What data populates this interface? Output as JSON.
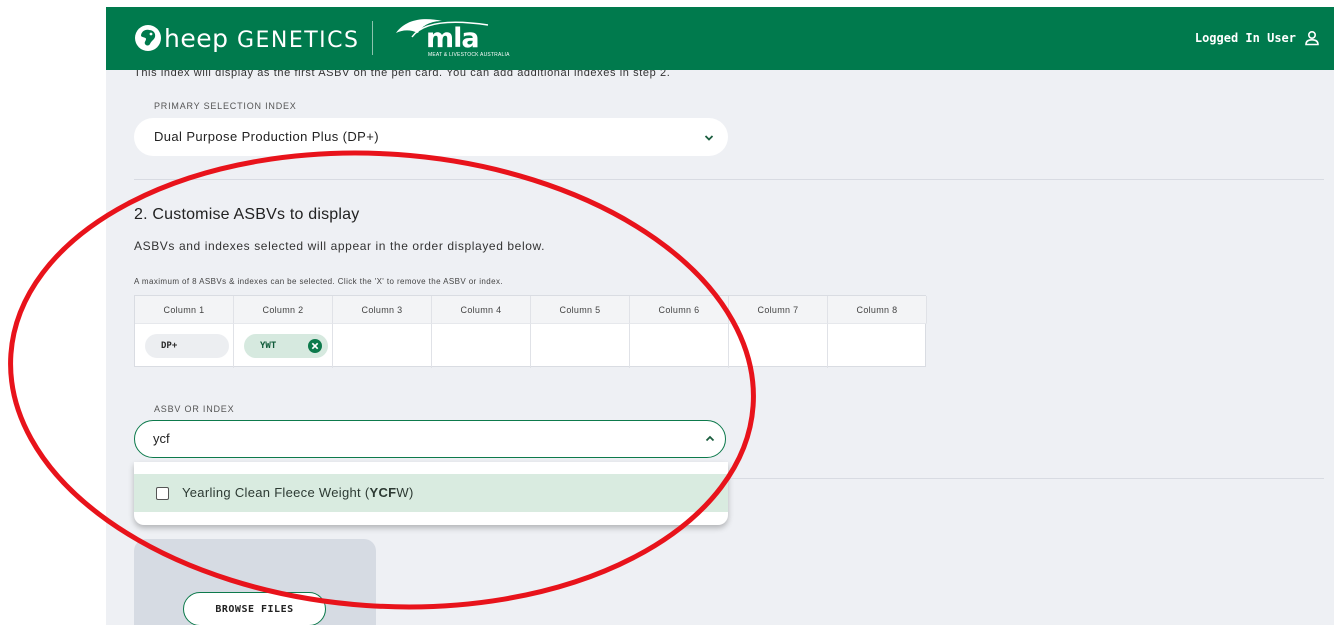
{
  "header": {
    "brand_initial_glyph": "sheep-head-icon",
    "brand_text_a": "heep ",
    "brand_text_b": "GENETICS",
    "partner_logo_text": "mla",
    "partner_logo_subtext": "MEAT & LIVESTOCK AUSTRALIA",
    "user_label": "Logged In User",
    "bg_color": "#007a4d"
  },
  "step1": {
    "intro_text": "This index will display as the first ASBV on the pen card. You can add additional indexes in step 2.",
    "primary_index_label": "PRIMARY SELECTION INDEX",
    "primary_index_value": "Dual Purpose Production Plus (DP+)"
  },
  "step2": {
    "title": "2. Customise ASBVs to display",
    "description": "ASBVs and indexes selected will appear in the order displayed below.",
    "note": "A maximum of 8 ASBVs & indexes can be selected. Click the 'X' to remove the ASBV or index.",
    "columns": [
      "Column 1",
      "Column 2",
      "Column 3",
      "Column 4",
      "Column 5",
      "Column 6",
      "Column 7",
      "Column 8"
    ],
    "chips": [
      {
        "label": "DP+",
        "removable": false
      },
      {
        "label": "YWT",
        "removable": true
      }
    ],
    "asbv_label": "ASBV OR INDEX",
    "asbv_input_value": "ycf",
    "options": [
      {
        "prefix": "Yearling Clean Fleece Weight (",
        "match": "YCF",
        "suffix": "W)",
        "checked": false
      }
    ]
  },
  "upload": {
    "browse_label": "BROWSE FILES"
  },
  "colors": {
    "accent": "#0d7a4c",
    "chip_green": "#d6e9df",
    "annotation_red": "#e8131b"
  }
}
